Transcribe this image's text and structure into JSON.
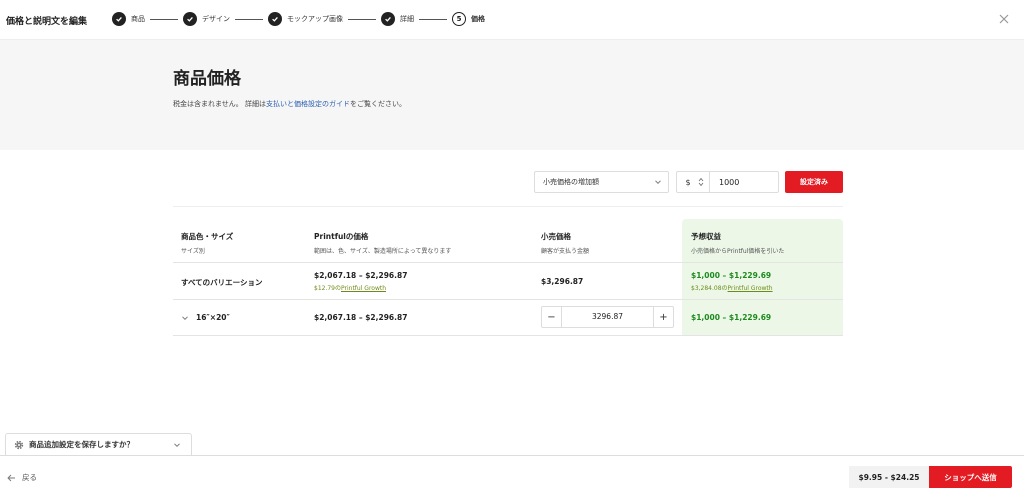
{
  "header": {
    "title": "価格と説明文を編集",
    "steps": [
      {
        "label": "商品",
        "done": true
      },
      {
        "label": "デザイン",
        "done": true
      },
      {
        "label": "モックアップ画像",
        "done": true
      },
      {
        "label": "詳細",
        "done": true
      },
      {
        "label": "価格",
        "number": "5",
        "current": true
      }
    ]
  },
  "hero": {
    "title": "商品価格",
    "desc_prefix": "税金は含まれません。 詳細は",
    "desc_link": "支払いと価格設定のガイド",
    "desc_suffix": "をご覧ください。"
  },
  "controls": {
    "select_value": "小売価格の増加額",
    "currency": "$",
    "amount": "1000",
    "apply_label": "設定済み"
  },
  "table": {
    "headers": [
      {
        "title": "商品色・サイズ",
        "sub": "サイズ別"
      },
      {
        "title": "Printfulの価格",
        "sub": "範囲は、色、サイズ、製造場所によって異なります"
      },
      {
        "title": "小売価格",
        "sub": "顧客が支払う金額"
      },
      {
        "title": "予想収益",
        "sub": "小売価格からPrintful価格を引いた"
      }
    ],
    "all_row": {
      "label": "すべてのバリエーション",
      "printful": "$2,067.18 – $2,296.87",
      "printful_sub_prefix": "$12.79の",
      "printful_sub_link": "Printful Growth",
      "retail": "$3,296.87",
      "profit": "$1,000 – $1,229.69",
      "profit_sub_prefix": "$3,284.08の",
      "profit_sub_link": "Printful Growth"
    },
    "size_row": {
      "label": "16″×20″",
      "printful": "$2,067.18 – $2,296.87",
      "retail_value": "3296.87",
      "minus": "−",
      "plus": "+",
      "profit": "$1,000 – $1,229.69"
    }
  },
  "bottom": {
    "save_toggle": "商品追加設定を保存しますか？",
    "back": "戻る",
    "range": "$9.95 - $24.25",
    "send": "ショップへ送信"
  },
  "colors": {
    "accent": "#e31b23",
    "profit_green": "#1e8a1e",
    "profit_bg": "#ecf7e8",
    "link": "#2a5db0"
  }
}
